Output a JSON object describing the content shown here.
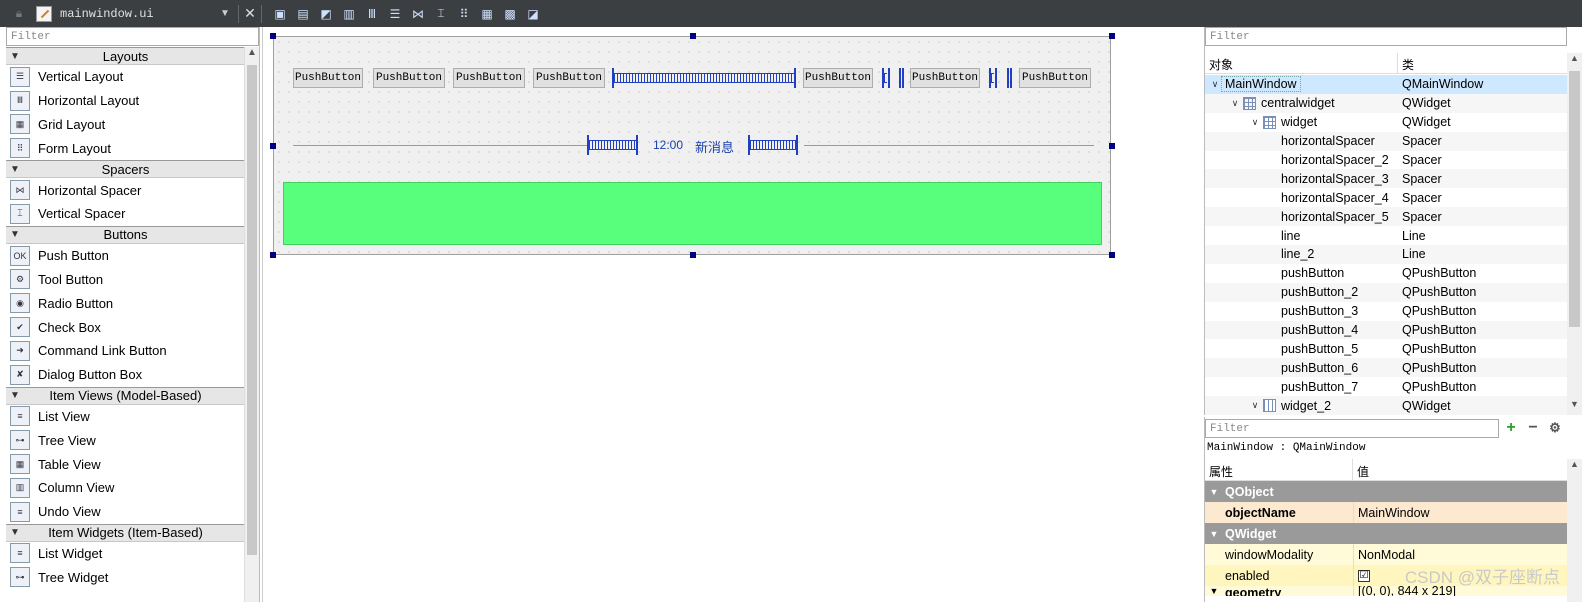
{
  "toolbar": {
    "file_name": "mainwindow.ui",
    "tools": [
      "send-to-back-icon",
      "bring-to-front-icon",
      "edit-buddies-icon",
      "edit-tab-order-icon",
      "layout-horizontal-icon",
      "layout-vertical-icon",
      "layout-hsplit-icon",
      "layout-vsplit-icon",
      "layout-form-icon",
      "layout-grid-icon",
      "break-layout-icon",
      "adjust-size-icon"
    ]
  },
  "widget_box": {
    "filter_placeholder": "Filter",
    "categories": [
      {
        "label": "Layouts",
        "items": [
          "Vertical Layout",
          "Horizontal Layout",
          "Grid Layout",
          "Form Layout"
        ]
      },
      {
        "label": "Spacers",
        "items": [
          "Horizontal Spacer",
          "Vertical Spacer"
        ]
      },
      {
        "label": "Buttons",
        "items": [
          "Push Button",
          "Tool Button",
          "Radio Button",
          "Check Box",
          "Command Link Button",
          "Dialog Button Box"
        ]
      },
      {
        "label": "Item Views (Model-Based)",
        "items": [
          "List View",
          "Tree View",
          "Table View",
          "Column View",
          "Undo View"
        ]
      },
      {
        "label": "Item Widgets (Item-Based)",
        "items": [
          "List Widget",
          "Tree Widget"
        ]
      }
    ]
  },
  "form": {
    "buttons": [
      "PushButton",
      "PushButton",
      "PushButton",
      "PushButton",
      "PushButton",
      "PushButton",
      "PushButton"
    ],
    "time_text": "12:00",
    "message_text": "新消息",
    "green_color": "#58ff7d"
  },
  "object_inspector": {
    "filter_placeholder": "Filter",
    "col_object": "对象",
    "col_class": "类",
    "rows": [
      {
        "name": "MainWindow",
        "cls": "QMainWindow"
      },
      {
        "name": "centralwidget",
        "cls": "QWidget"
      },
      {
        "name": "widget",
        "cls": "QWidget"
      },
      {
        "name": "horizontalSpacer",
        "cls": "Spacer"
      },
      {
        "name": "horizontalSpacer_2",
        "cls": "Spacer"
      },
      {
        "name": "horizontalSpacer_3",
        "cls": "Spacer"
      },
      {
        "name": "horizontalSpacer_4",
        "cls": "Spacer"
      },
      {
        "name": "horizontalSpacer_5",
        "cls": "Spacer"
      },
      {
        "name": "line",
        "cls": "Line"
      },
      {
        "name": "line_2",
        "cls": "Line"
      },
      {
        "name": "pushButton",
        "cls": "QPushButton"
      },
      {
        "name": "pushButton_2",
        "cls": "QPushButton"
      },
      {
        "name": "pushButton_3",
        "cls": "QPushButton"
      },
      {
        "name": "pushButton_4",
        "cls": "QPushButton"
      },
      {
        "name": "pushButton_5",
        "cls": "QPushButton"
      },
      {
        "name": "pushButton_6",
        "cls": "QPushButton"
      },
      {
        "name": "pushButton_7",
        "cls": "QPushButton"
      },
      {
        "name": "widget_2",
        "cls": "QWidget"
      }
    ]
  },
  "property_editor": {
    "filter_placeholder": "Filter",
    "class_line": "MainWindow : QMainWindow",
    "col_property": "属性",
    "col_value": "值",
    "group_qobject": "QObject",
    "object_name_key": "objectName",
    "object_name_value": "MainWindow",
    "group_qwidget": "QWidget",
    "window_modality_key": "windowModality",
    "window_modality_value": "NonModal",
    "enabled_key": "enabled",
    "enabled_check": "☑",
    "geometry_key": "geometry",
    "geometry_value": "[(0, 0), 844 x 219]"
  },
  "watermark": "CSDN @双子座断点"
}
